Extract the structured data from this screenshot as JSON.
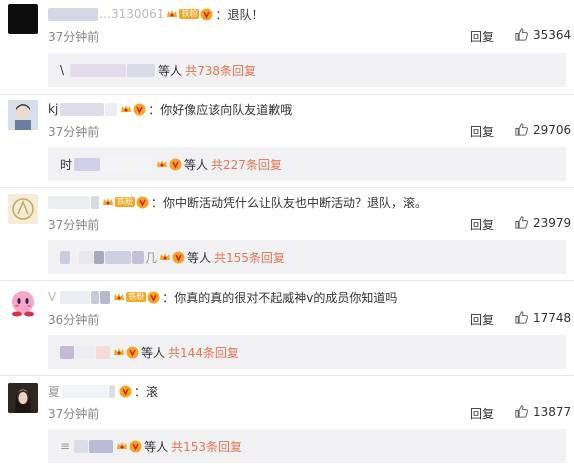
{
  "comments": [
    {
      "name_visible": "…3130061",
      "text": "：退队！",
      "time": "37分钟前",
      "reply_label": "回复",
      "likes": "35364",
      "sub": {
        "first": "\\",
        "etc": "等人",
        "total": "共738条回复"
      }
    },
    {
      "name_visible": "kj",
      "text": "：你好像应该向队友道歉哦",
      "time": "37分钟前",
      "reply_label": "回复",
      "likes": "29706",
      "sub": {
        "first": "时",
        "etc": "等人",
        "total": "共227条回复"
      }
    },
    {
      "name_visible": "",
      "fan_tag": "铁粉",
      "text": "：你中断活动凭什么让队友也中断活动？退队，滚。",
      "time": "37分钟前",
      "reply_label": "回复",
      "likes": "23979",
      "sub": {
        "first": "",
        "tail": "几",
        "etc": "等人",
        "total": "共155条回复"
      }
    },
    {
      "name_visible": "V",
      "fan_tag": "铁粉",
      "text": "：你真的真的很对不起威神v的成员你知道吗",
      "time": "36分钟前",
      "reply_label": "回复",
      "likes": "17748",
      "sub": {
        "first": "",
        "etc": "等人",
        "total": "共144条回复"
      }
    },
    {
      "name_visible": "夏",
      "text": "：滚",
      "time": "37分钟前",
      "reply_label": "回复",
      "likes": "13877",
      "sub": {
        "first": "≡",
        "etc": "等人",
        "total": "共153条回复"
      }
    }
  ],
  "icons": {
    "like": "thumbs-up-icon",
    "crown": "crown-badge-icon",
    "vip": "vip-icon"
  },
  "colors": {
    "accent_link": "#eb7350",
    "badge_orange": "#f5a623",
    "sub_bg": "#f2f2f5"
  }
}
